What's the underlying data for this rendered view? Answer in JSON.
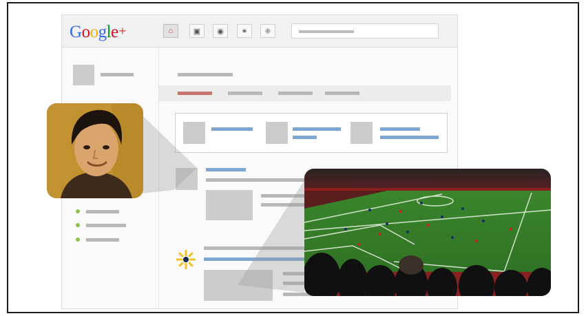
{
  "app": {
    "logo_text": "Google",
    "logo_plus": "+"
  },
  "toolbar": {
    "nav_icons": [
      "home-icon",
      "photos-icon",
      "profile-icon",
      "circles-icon",
      "games-icon"
    ],
    "active_index": 0
  },
  "search": {
    "placeholder": ""
  },
  "colors": {
    "logo_blue": "#3369e8",
    "logo_red": "#d50f25",
    "logo_yellow": "#eeb211",
    "logo_green": "#009925",
    "accent_blue": "#7ea6d3",
    "accent_red": "#c4756e",
    "online_green": "#8bc34a",
    "spark_yellow": "#f3c21b"
  },
  "photos": [
    {
      "name": "profile-photo",
      "subject": "smiling young man"
    },
    {
      "name": "stadium-photo",
      "subject": "soccer match in a stadium"
    }
  ]
}
